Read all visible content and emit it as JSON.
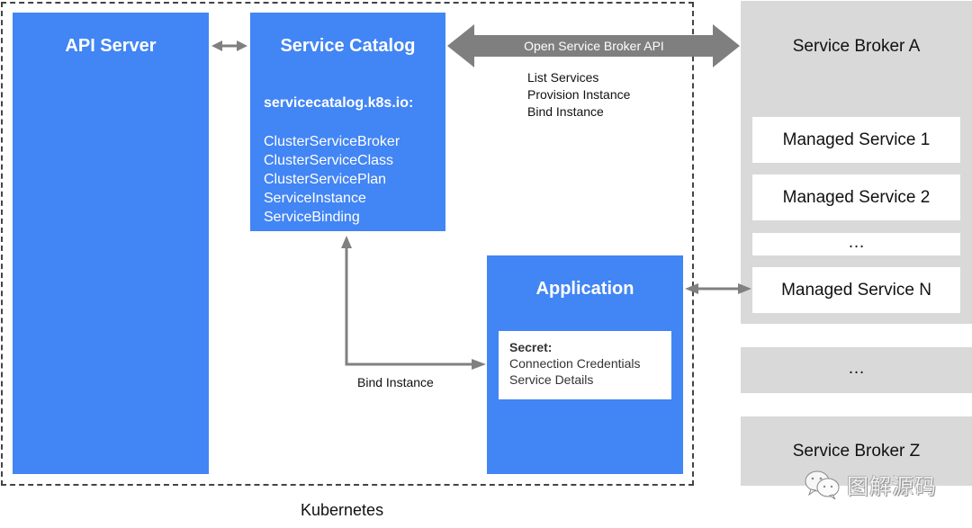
{
  "diagram": {
    "cluster_label": "Kubernetes",
    "api_server": {
      "title": "API Server"
    },
    "service_catalog": {
      "title": "Service Catalog",
      "api_group": "servicecatalog.k8s.io:",
      "resources": [
        "ClusterServiceBroker",
        "ClusterServiceClass",
        "ClusterServicePlan",
        "ServiceInstance",
        "ServiceBinding"
      ]
    },
    "application": {
      "title": "Application",
      "secret": {
        "label": "Secret:",
        "lines": [
          "Connection Credentials",
          "Service Details"
        ]
      }
    },
    "open_service_broker": {
      "label": "Open Service Broker API",
      "operations": [
        "List Services",
        "Provision Instance",
        "Bind Instance"
      ]
    },
    "bind_arrow_label": "Bind Instance",
    "broker_a": {
      "name": "Service Broker A",
      "services": [
        "Managed Service 1",
        "Managed Service 2",
        "…",
        "Managed Service N"
      ]
    },
    "broker_ellipsis": "…",
    "broker_z": {
      "name": "Service Broker Z"
    },
    "watermark": {
      "icon": "wechat-icon",
      "text": "图解源码"
    },
    "colors": {
      "component_blue": "#4285f4",
      "broker_gray": "#d9d9d9",
      "arrow_gray": "#808080",
      "frame_dash": "#444444"
    }
  }
}
